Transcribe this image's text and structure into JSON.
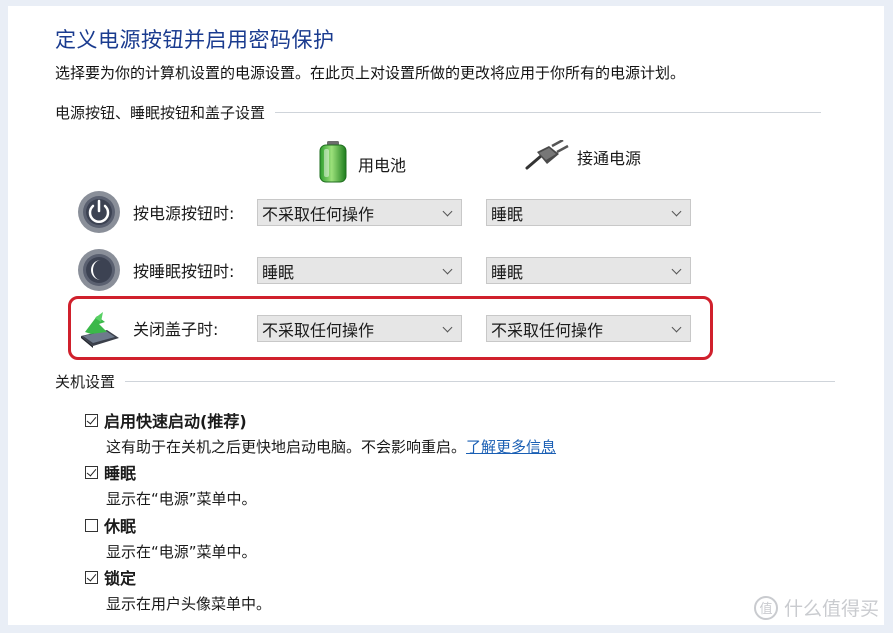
{
  "page": {
    "title": "定义电源按钮并启用密码保护",
    "subtitle": "选择要为你的计算机设置的电源设置。在此页上对设置所做的更改将应用于你所有的电源计划。"
  },
  "power_section": {
    "heading": "电源按钮、睡眠按钮和盖子设置",
    "col_battery": "用电池",
    "col_plugged": "接通电源",
    "rows": [
      {
        "label": "按电源按钮时:",
        "battery": "不采取任何操作",
        "plugged": "睡眠",
        "icon": "power-button-icon"
      },
      {
        "label": "按睡眠按钮时:",
        "battery": "睡眠",
        "plugged": "睡眠",
        "icon": "sleep-button-icon"
      },
      {
        "label": "关闭盖子时:",
        "battery": "不采取任何操作",
        "plugged": "不采取任何操作",
        "icon": "laptop-lid-icon"
      }
    ]
  },
  "shutdown_section": {
    "heading": "关机设置",
    "options": [
      {
        "title": "启用快速启动(推荐)",
        "checked": true,
        "desc": "这有助于在关机之后更快地启动电脑。不会影响重启。",
        "link": "了解更多信息"
      },
      {
        "title": "睡眠",
        "checked": true,
        "desc": "显示在“电源”菜单中。"
      },
      {
        "title": "休眠",
        "checked": false,
        "desc": "显示在“电源”菜单中。"
      },
      {
        "title": "锁定",
        "checked": true,
        "desc": "显示在用户头像菜单中。"
      }
    ]
  },
  "colors": {
    "title": "#1a3b8f",
    "highlight": "#d0202c",
    "link": "#1a5fb4"
  },
  "watermark": {
    "mark": "值",
    "text": "什么值得买"
  }
}
